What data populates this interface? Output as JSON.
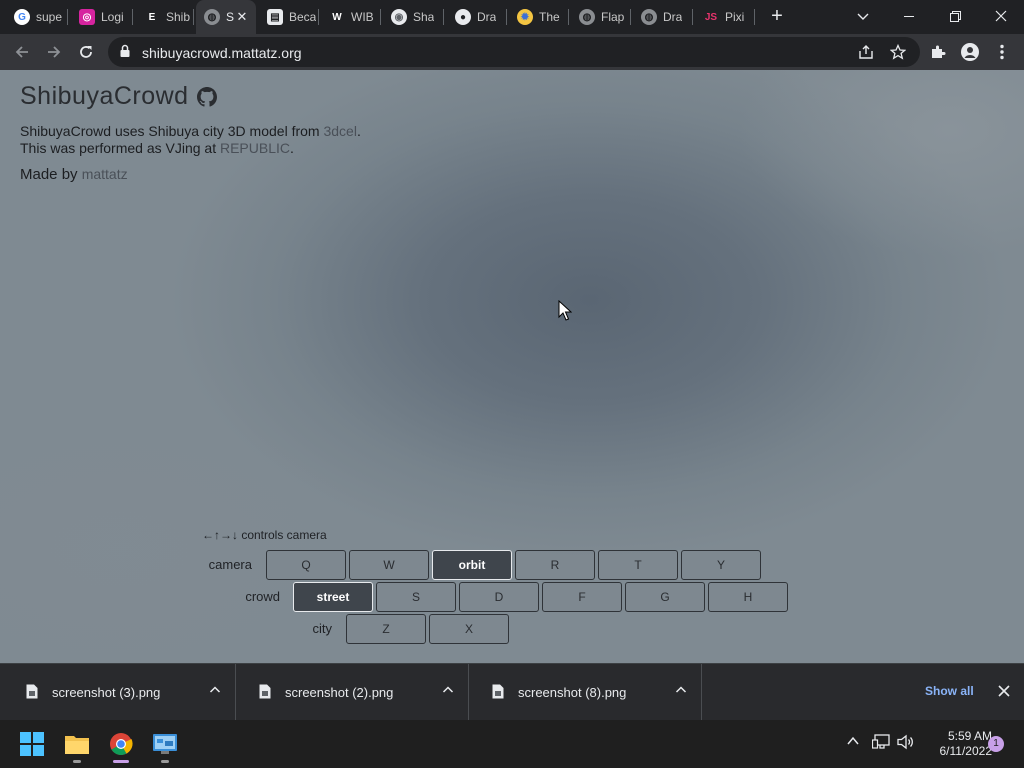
{
  "tabs": [
    {
      "label": "supe",
      "favicon": "google-icon"
    },
    {
      "label": "Logi",
      "favicon": "instagram-icon"
    },
    {
      "label": "Shib",
      "favicon": "e-icon"
    },
    {
      "label": "S",
      "favicon": "globe-icon",
      "active": true
    },
    {
      "label": "Beca",
      "favicon": "doc-icon"
    },
    {
      "label": "WIB",
      "favicon": "w-icon"
    },
    {
      "label": "Sha",
      "favicon": "spiral-icon"
    },
    {
      "label": "Dra",
      "favicon": "github-icon"
    },
    {
      "label": "The",
      "favicon": "badge-icon"
    },
    {
      "label": "Flap",
      "favicon": "globe-icon"
    },
    {
      "label": "Dra",
      "favicon": "globe-icon"
    },
    {
      "label": "Pixi",
      "favicon": "js-icon"
    }
  ],
  "toolbar": {
    "url": "shibuyacrowd.mattatz.org"
  },
  "page": {
    "title": "ShibuyaCrowd",
    "line1_prefix": "ShibuyaCrowd uses Shibuya city 3D model from ",
    "line1_link": "3dcel",
    "line1_suffix": ".",
    "line2_prefix": "This was performed as VJing at ",
    "line2_link": "REPUBLIC",
    "line2_suffix": ".",
    "madeby_prefix": "Made by ",
    "madeby_link": "mattatz",
    "controls_hint": "←↑→↓ controls camera",
    "rows": {
      "camera": {
        "label": "camera",
        "keys": [
          "Q",
          "W",
          "orbit",
          "R",
          "T",
          "Y"
        ],
        "selected": "orbit"
      },
      "crowd": {
        "label": "crowd",
        "keys": [
          "street",
          "S",
          "D",
          "F",
          "G",
          "H"
        ],
        "selected": "street"
      },
      "city": {
        "label": "city",
        "keys": [
          "Z",
          "X"
        ],
        "selected": ""
      }
    }
  },
  "downloads": {
    "items": [
      "screenshot (3).png",
      "screenshot (2).png",
      "screenshot (8).png"
    ],
    "show_all": "Show all"
  },
  "taskbar": {
    "time": "5:59 AM",
    "date": "6/11/2022",
    "notifications": "1"
  }
}
